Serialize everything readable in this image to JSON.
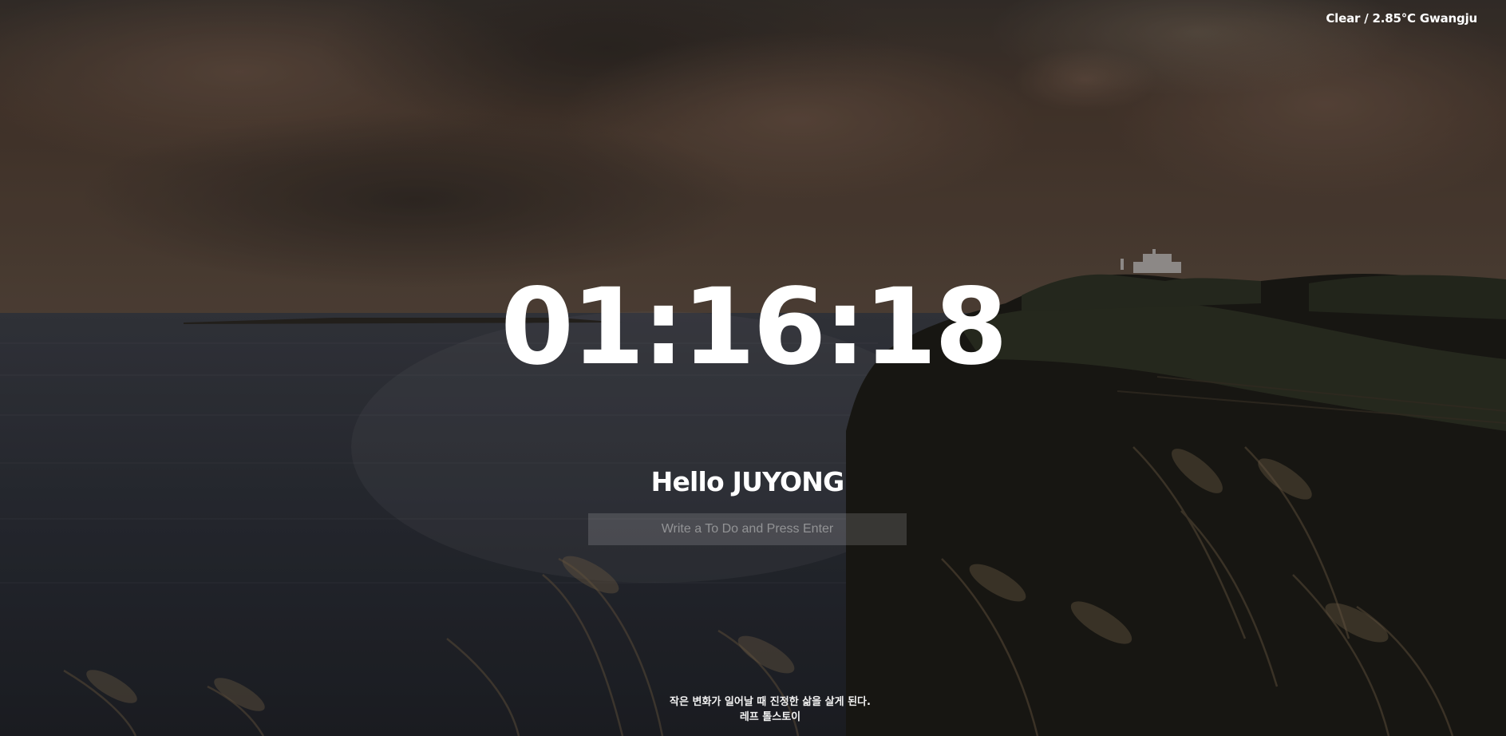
{
  "weather": {
    "text": "Clear / 2.85°C Gwangju"
  },
  "clock": {
    "time": "01:16:18"
  },
  "greeting": {
    "text": "Hello JUYONG"
  },
  "todo": {
    "placeholder": "Write a To Do and Press Enter"
  },
  "quote": {
    "text": "작은 변화가 일어날 때 진정한 삶을 살게 된다.",
    "author": "레프 톨스토이"
  },
  "colors": {
    "text": "#ffffff",
    "sky": "#4a3a30",
    "sea": "#2a2c33",
    "cliff": "#1b1a16"
  }
}
